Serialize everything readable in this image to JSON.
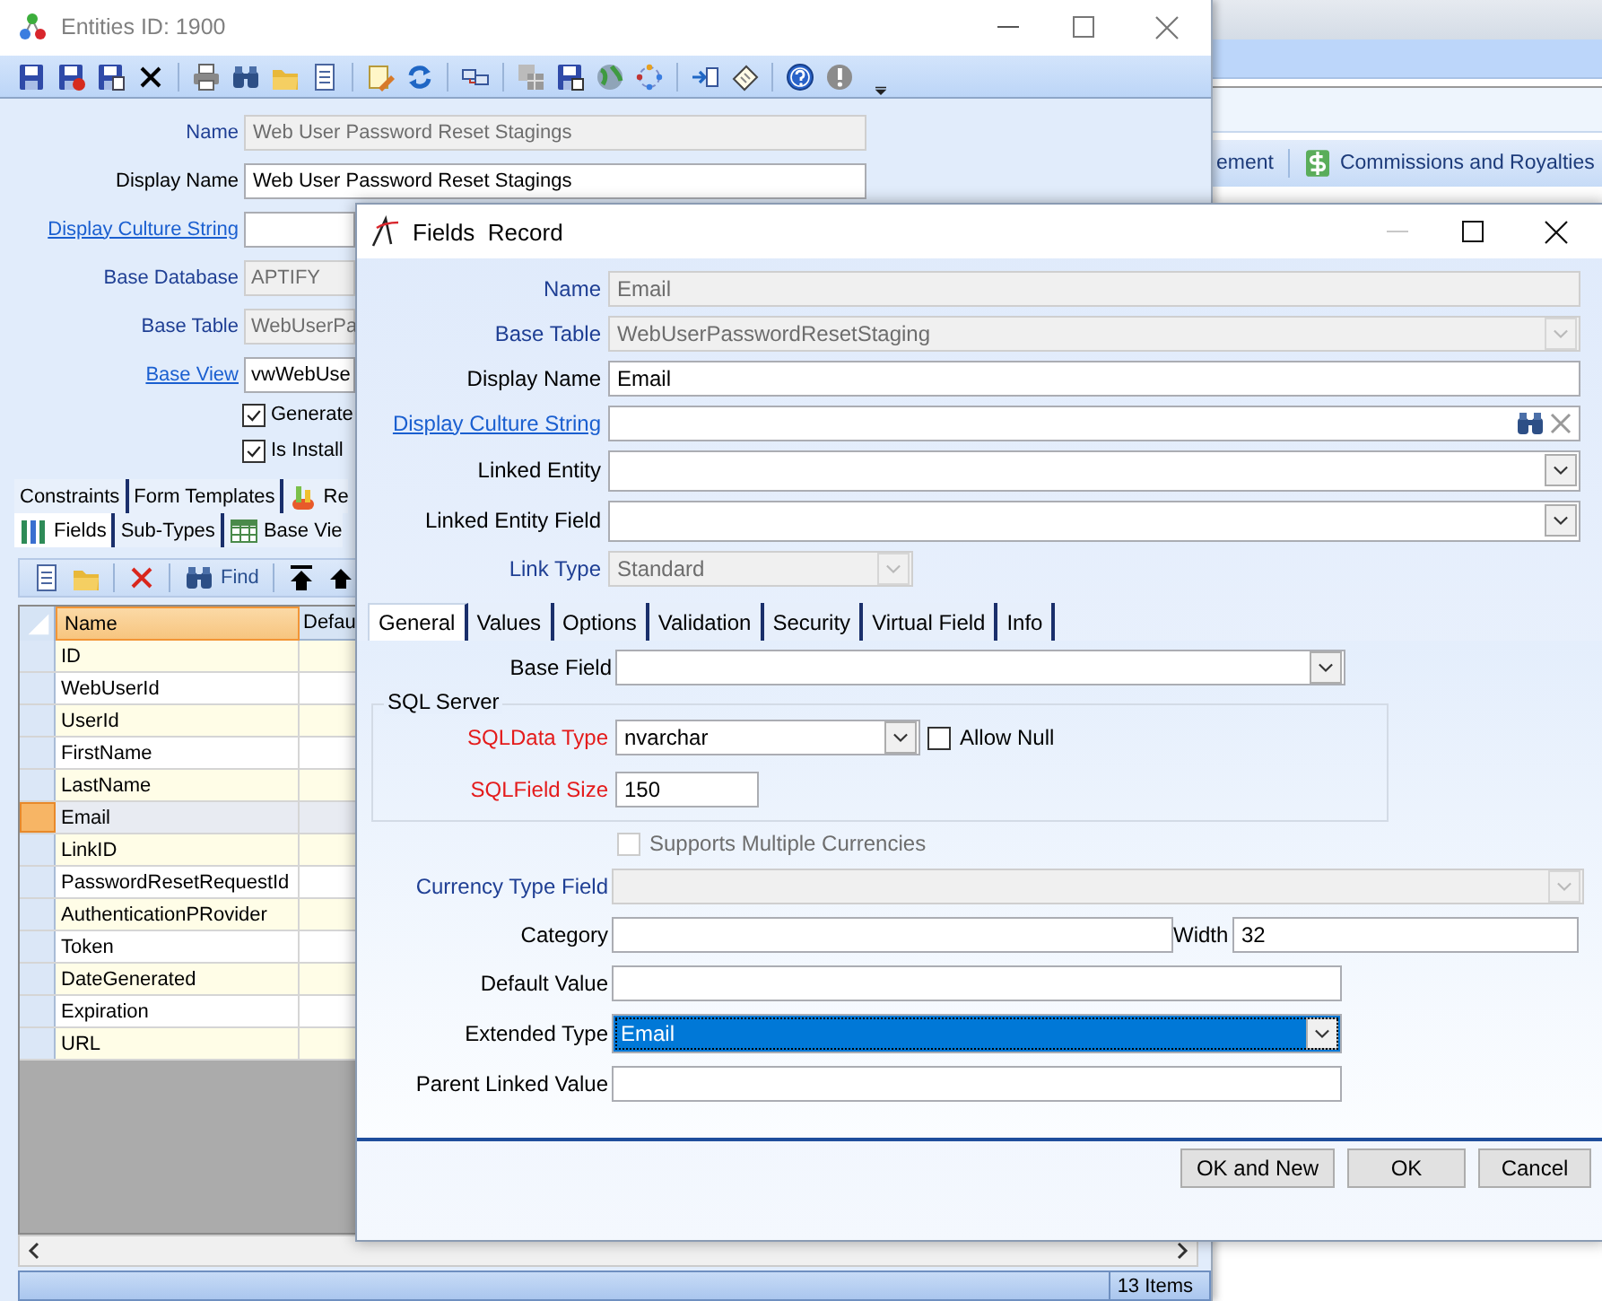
{
  "background_app": {
    "ribbon_items": [
      {
        "label": "ement",
        "kind": "plain"
      },
      {
        "label": "Commissions and Royalties",
        "kind": "dollar"
      }
    ]
  },
  "entities_window": {
    "title": "Entities ID: 1900",
    "fields": [
      {
        "label": {
          "text": "Name",
          "kind": "plain"
        },
        "value": "Web User Password Reset Stagings",
        "disabled": true
      },
      {
        "label": {
          "text": "Display Name",
          "kind": "plain"
        },
        "value": "Web User Password Reset Stagings",
        "disabled": false
      },
      {
        "label": {
          "text": "Display Culture String",
          "kind": "link"
        },
        "disabled": false
      },
      {
        "label": {
          "text": "Base Database",
          "kind": "plain"
        },
        "value": "APTIFY",
        "disabled": true
      },
      {
        "label": {
          "text": "Base Table",
          "kind": "plain"
        },
        "value": "WebUserPa",
        "disabled": true
      },
      {
        "label": {
          "text": "Base View",
          "kind": "link"
        },
        "value": "vwWebUse",
        "disabled": false
      }
    ],
    "checkboxes": [
      {
        "label": "Generate",
        "checked": true
      },
      {
        "label": "Is Install",
        "checked": true
      }
    ],
    "tabs_row_1": [
      {
        "label": "Constraints",
        "kind": "plain",
        "selected": false
      },
      {
        "label": "Form Templates",
        "kind": "plain",
        "selected": false
      },
      {
        "label": "Re",
        "kind": "icon",
        "selected": false
      }
    ],
    "tabs_row_2": [
      {
        "label": "Fields",
        "kind": "icon",
        "selected": true
      },
      {
        "label": "Sub-Types",
        "kind": "plain",
        "selected": false
      },
      {
        "label": "Base Vie",
        "kind": "icon",
        "selected": false
      }
    ],
    "grid_toolbar": {
      "find_label": "Find"
    },
    "grid": {
      "columns": [
        "Name",
        "Defau"
      ],
      "rows": [
        {
          "name": "ID",
          "selected": false
        },
        {
          "name": "WebUserId",
          "selected": false
        },
        {
          "name": "UserId",
          "selected": false
        },
        {
          "name": "FirstName",
          "selected": false
        },
        {
          "name": "LastName",
          "selected": false
        },
        {
          "name": "Email",
          "selected": true
        },
        {
          "name": "LinkID",
          "selected": false
        },
        {
          "name": "PasswordResetRequestId",
          "selected": false
        },
        {
          "name": "AuthenticationPRovider",
          "selected": false
        },
        {
          "name": "Token",
          "selected": false
        },
        {
          "name": "DateGenerated",
          "selected": false
        },
        {
          "name": "Expiration",
          "selected": false
        },
        {
          "name": "URL",
          "selected": false
        }
      ]
    },
    "status": "13 Items"
  },
  "fields_dialog": {
    "title": "Fields  Record",
    "fields": [
      {
        "label": {
          "text": "Name",
          "kind": "plain"
        },
        "kind": "text",
        "value": "Email",
        "disabled": true
      },
      {
        "label": {
          "text": "Base Table",
          "kind": "plain"
        },
        "kind": "select",
        "value": "WebUserPasswordResetStaging",
        "disabled": true
      },
      {
        "label": {
          "text": "Display Name",
          "kind": "plain"
        },
        "kind": "text",
        "value": "Email",
        "disabled": false
      },
      {
        "label": {
          "text": "Display Culture String",
          "kind": "link"
        },
        "kind": "lookup",
        "disabled": false
      },
      {
        "label": {
          "text": "Linked Entity",
          "kind": "plain"
        },
        "kind": "select",
        "disabled": false
      },
      {
        "label": {
          "text": "Linked Entity Field",
          "kind": "plain"
        },
        "kind": "select",
        "disabled": false
      },
      {
        "label": {
          "text": "Link Type",
          "kind": "plain"
        },
        "kind": "select",
        "value": "Standard",
        "disabled": true
      }
    ],
    "tabs": [
      {
        "label": "General",
        "selected": true
      },
      {
        "label": "Values",
        "selected": false
      },
      {
        "label": "Options",
        "selected": false
      },
      {
        "label": "Validation",
        "selected": false
      },
      {
        "label": "Security",
        "selected": false
      },
      {
        "label": "Virtual Field",
        "selected": false
      },
      {
        "label": "Info",
        "selected": false
      }
    ],
    "general_tab": {
      "base_field": {
        "label": {
          "text": "Base Field",
          "kind": "plain"
        }
      },
      "sql_server": {
        "title": "SQL Server",
        "data_type": {
          "label": {
            "text": "SQLData Type",
            "kind": "required"
          },
          "value": "nvarchar"
        },
        "allow_null": {
          "label": "Allow Null",
          "checked": false
        },
        "field_size": {
          "label": {
            "text": "SQLField Size",
            "kind": "required"
          },
          "value": "150"
        }
      },
      "supports_multiple_currencies": {
        "label": "Supports Multiple Currencies",
        "checked": false,
        "disabled": true
      },
      "currency_type_field": {
        "label": {
          "text": "Currency Type Field",
          "kind": "plain"
        },
        "disabled": true
      },
      "category": {
        "label": {
          "text": "Category",
          "kind": "plain"
        }
      },
      "width": {
        "label": "Width",
        "value": "32"
      },
      "default_value": {
        "label": {
          "text": "Default Value",
          "kind": "plain"
        }
      },
      "extended_type": {
        "label": {
          "text": "Extended Type",
          "kind": "plain"
        },
        "value": "Email",
        "focused": true
      },
      "parent_linked_value": {
        "label": {
          "text": "Parent Linked Value",
          "kind": "plain"
        }
      }
    },
    "buttons": [
      "OK and New",
      "OK",
      "Cancel"
    ]
  }
}
